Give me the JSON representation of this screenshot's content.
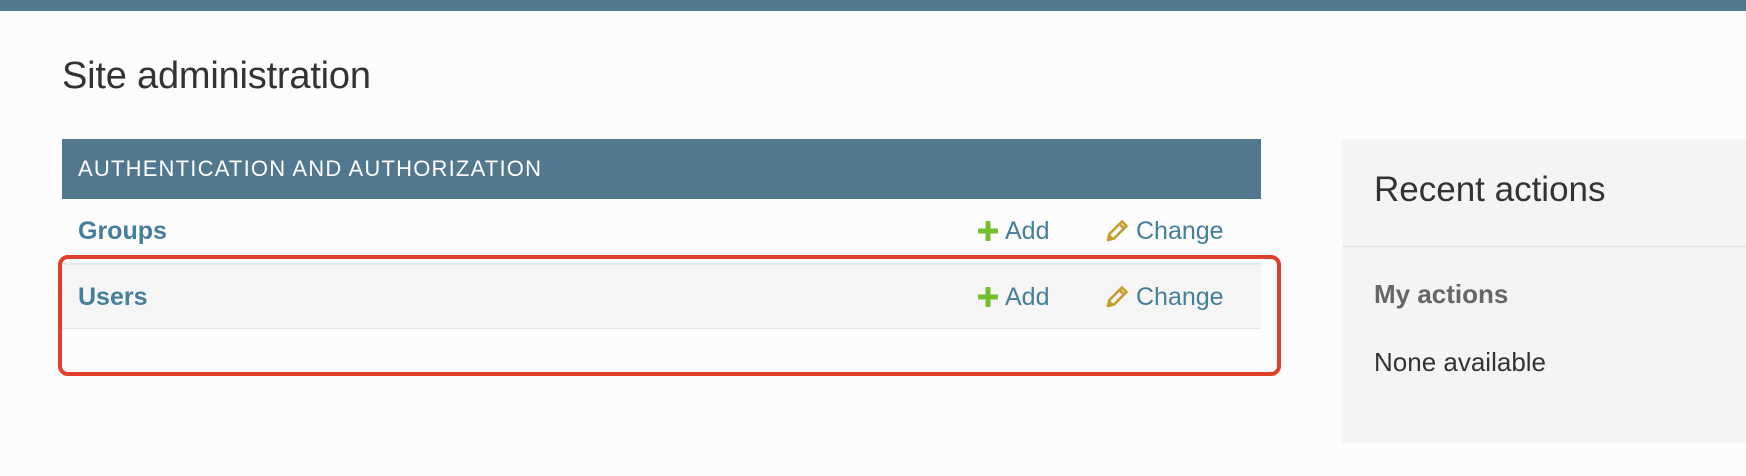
{
  "page": {
    "title": "Site administration"
  },
  "colors": {
    "header_bar": "#527890",
    "link": "#447e9b",
    "add_icon": "#70bf2b",
    "change_icon": "#c59b2b",
    "highlight_border": "#e0402a"
  },
  "module": {
    "caption": "AUTHENTICATION AND AUTHORIZATION",
    "models": [
      {
        "name": "Groups",
        "add_label": "Add",
        "change_label": "Change",
        "add_icon": "plus-icon",
        "change_icon": "pencil-icon"
      },
      {
        "name": "Users",
        "add_label": "Add",
        "change_label": "Change",
        "add_icon": "plus-icon",
        "change_icon": "pencil-icon"
      }
    ]
  },
  "recent_actions": {
    "title": "Recent actions",
    "subtitle": "My actions",
    "empty_text": "None available"
  }
}
